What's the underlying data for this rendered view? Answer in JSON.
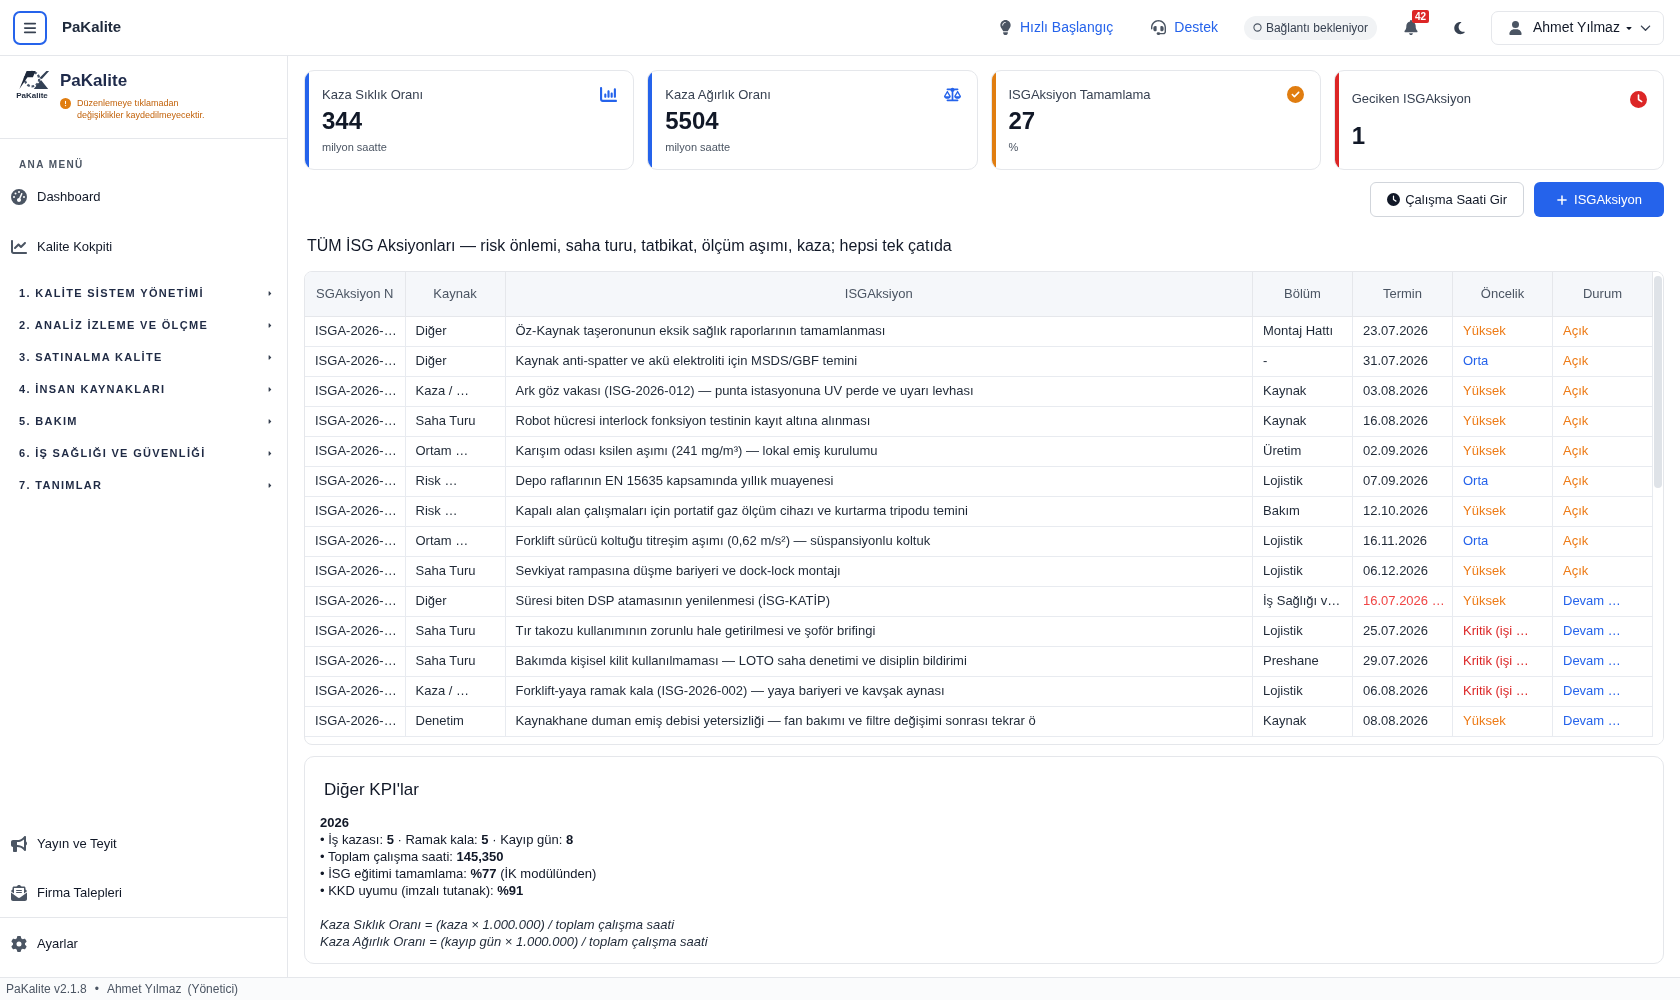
{
  "header": {
    "app_name": "PaKalite",
    "quick_start": "Hızlı Başlangıç",
    "support": "Destek",
    "connection": "Bağlantı bekleniyor",
    "notification_count": "42",
    "user": "Ahmet Yılmaz"
  },
  "sidebar": {
    "logo_wordmark": "PaKalite",
    "brand": "PaKalite",
    "notice": "Düzenlemeye tıklamadan değişiklikler kaydedilmeyecektir.",
    "menu_title": "ANA MENÜ",
    "links": [
      "Dashboard",
      "Kalite Kokpiti"
    ],
    "sections": [
      {
        "label": "1. KALİTE SİSTEM YÖNETİMİ",
        "expanded": false
      },
      {
        "label": "2. ANALİZ İZLEME VE ÖLÇME",
        "expanded": false
      },
      {
        "label": "3. SATINALMA KALİTE",
        "expanded": false
      },
      {
        "label": "4. İNSAN KAYNAKLARI",
        "expanded": false
      },
      {
        "label": "5. BAKIM",
        "expanded": false
      },
      {
        "label": "6. İŞ SAĞLIĞI VE GÜVENLİĞİ",
        "expanded": false
      },
      {
        "label": "7. TANIMLAR",
        "expanded": false
      }
    ],
    "bottom_links": [
      "Yayın ve Teyit",
      "Firma Talepleri"
    ],
    "settings": "Ayarlar"
  },
  "kpi_cards": [
    {
      "title": "Kaza Sıklık Oranı",
      "value": "344",
      "unit": "milyon saatte",
      "color": "#2563eb"
    },
    {
      "title": "Kaza Ağırlık Oranı",
      "value": "5504",
      "unit": "milyon saatte",
      "color": "#2563eb"
    },
    {
      "title": "ISGAksiyon Tamamlama",
      "value": "27",
      "unit": "%",
      "color": "#e07d10"
    },
    {
      "title": "Geciken ISGAksiyon",
      "value": "1",
      "color": "#dc2626"
    }
  ],
  "actions": {
    "hours_button": "Çalışma Saati Gir",
    "add_button": "ISGAksiyon"
  },
  "table": {
    "title": "TÜM İSG Aksiyonları — risk önlemi, saha turu, tatbikat, ölçüm aşımı, kaza; hepsi tek çatıda",
    "columns": [
      "SGAksiyon N",
      "Kaynak",
      "ISGAksiyon",
      "Bölüm",
      "Termin",
      "Öncelik",
      "Durum"
    ],
    "rows": [
      {
        "id": "ISGA-2026-…",
        "source": "Diğer",
        "action": "Öz-Kaynak taşeronunun eksik sağlık raporlarının tamamlanması",
        "department": "Montaj Hattı",
        "due": {
          "text": "23.07.2026",
          "overdue": false
        },
        "priority": {
          "text": "Yüksek",
          "color": "#ee7b16"
        },
        "status": {
          "text": "Açık",
          "color": "#ee7b16"
        }
      },
      {
        "id": "ISGA-2026-…",
        "source": "Diğer",
        "action": "Kaynak anti-spatter ve akü elektroliti için MSDS/GBF temini",
        "department": "-",
        "due": {
          "text": "31.07.2026",
          "overdue": false
        },
        "priority": {
          "text": "Orta",
          "color": "#2563eb"
        },
        "status": {
          "text": "Açık",
          "color": "#ee7b16"
        }
      },
      {
        "id": "ISGA-2026-…",
        "source": "Kaza / …",
        "action": "Ark göz vakası (ISG-2026-012) — punta istasyonuna UV perde ve uyarı levhası",
        "department": "Kaynak",
        "due": {
          "text": "03.08.2026",
          "overdue": false
        },
        "priority": {
          "text": "Yüksek",
          "color": "#ee7b16"
        },
        "status": {
          "text": "Açık",
          "color": "#ee7b16"
        }
      },
      {
        "id": "ISGA-2026-…",
        "source": "Saha Turu",
        "action": "Robot hücresi interlock fonksiyon testinin kayıt altına alınması",
        "department": "Kaynak",
        "due": {
          "text": "16.08.2026",
          "overdue": false
        },
        "priority": {
          "text": "Yüksek",
          "color": "#ee7b16"
        },
        "status": {
          "text": "Açık",
          "color": "#ee7b16"
        }
      },
      {
        "id": "ISGA-2026-…",
        "source": "Ortam …",
        "action": "Karışım odası ksilen aşımı (241 mg/m³) — lokal emiş kurulumu",
        "department": "Üretim",
        "due": {
          "text": "02.09.2026",
          "overdue": false
        },
        "priority": {
          "text": "Yüksek",
          "color": "#ee7b16"
        },
        "status": {
          "text": "Açık",
          "color": "#ee7b16"
        }
      },
      {
        "id": "ISGA-2026-…",
        "source": "Risk …",
        "action": "Depo raflarının EN 15635 kapsamında yıllık muayenesi",
        "department": "Lojistik",
        "due": {
          "text": "07.09.2026",
          "overdue": false
        },
        "priority": {
          "text": "Orta",
          "color": "#2563eb"
        },
        "status": {
          "text": "Açık",
          "color": "#ee7b16"
        }
      },
      {
        "id": "ISGA-2026-…",
        "source": "Risk …",
        "action": "Kapalı alan çalışmaları için portatif gaz ölçüm cihazı ve kurtarma tripodu temini",
        "department": "Bakım",
        "due": {
          "text": "12.10.2026",
          "overdue": false
        },
        "priority": {
          "text": "Yüksek",
          "color": "#ee7b16"
        },
        "status": {
          "text": "Açık",
          "color": "#ee7b16"
        }
      },
      {
        "id": "ISGA-2026-…",
        "source": "Ortam …",
        "action": "Forklift sürücü koltuğu titreşim aşımı (0,62 m/s²) — süspansiyonlu koltuk",
        "department": "Lojistik",
        "due": {
          "text": "16.11.2026",
          "overdue": false
        },
        "priority": {
          "text": "Orta",
          "color": "#2563eb"
        },
        "status": {
          "text": "Açık",
          "color": "#ee7b16"
        }
      },
      {
        "id": "ISGA-2026-…",
        "source": "Saha Turu",
        "action": "Sevkiyat rampasına düşme bariyeri ve dock-lock montajı",
        "department": "Lojistik",
        "due": {
          "text": "06.12.2026",
          "overdue": false
        },
        "priority": {
          "text": "Yüksek",
          "color": "#ee7b16"
        },
        "status": {
          "text": "Açık",
          "color": "#ee7b16"
        }
      },
      {
        "id": "ISGA-2026-…",
        "source": "Diğer",
        "action": "Süresi biten DSP atamasının yenilenmesi (İSG-KATİP)",
        "department": "İş Sağlığı v…",
        "due": {
          "text": "16.07.2026 …",
          "overdue": true
        },
        "priority": {
          "text": "Yüksek",
          "color": "#ee7b16"
        },
        "status": {
          "text": "Devam …",
          "color": "#2563eb"
        }
      },
      {
        "id": "ISGA-2026-…",
        "source": "Saha Turu",
        "action": "Tır takozu kullanımının zorunlu hale getirilmesi ve şoför brifingi",
        "department": "Lojistik",
        "due": {
          "text": "25.07.2026",
          "overdue": false
        },
        "priority": {
          "text": "Kritik (işi …",
          "color": "#dc2626"
        },
        "status": {
          "text": "Devam …",
          "color": "#2563eb"
        }
      },
      {
        "id": "ISGA-2026-…",
        "source": "Saha Turu",
        "action": "Bakımda kişisel kilit kullanılmaması — LOTO saha denetimi ve disiplin bildirimi",
        "department": "Preshane",
        "due": {
          "text": "29.07.2026",
          "overdue": false
        },
        "priority": {
          "text": "Kritik (işi …",
          "color": "#dc2626"
        },
        "status": {
          "text": "Devam …",
          "color": "#2563eb"
        }
      },
      {
        "id": "ISGA-2026-…",
        "source": "Kaza / …",
        "action": "Forklift-yaya ramak kala (ISG-2026-002) — yaya bariyeri ve kavşak aynası",
        "department": "Lojistik",
        "due": {
          "text": "06.08.2026",
          "overdue": false
        },
        "priority": {
          "text": "Kritik (işi …",
          "color": "#dc2626"
        },
        "status": {
          "text": "Devam …",
          "color": "#2563eb"
        }
      },
      {
        "id": "ISGA-2026-…",
        "source": "Denetim",
        "action": "Kaynakhane duman emiş debisi yetersizliği — fan bakımı ve filtre değişimi sonrası tekrar ö",
        "department": "Kaynak",
        "due": {
          "text": "08.08.2026",
          "overdue": false
        },
        "priority": {
          "text": "Yüksek",
          "color": "#ee7b16"
        },
        "status": {
          "text": "Devam …",
          "color": "#2563eb"
        }
      }
    ]
  },
  "kpi_panel": {
    "title": "Diğer KPI'lar",
    "year": "2026",
    "items": [
      "• İş kazası: **5** · Ramak kala: **5** · Kayıp gün: **8**",
      "• Toplam çalışma saati: **145,350**",
      "• İSG eğitimi tamamlama: **%77** (İK modülünden)",
      "• KKD uyumu (imzalı tutanak): **%91**"
    ],
    "formulas": [
      "Kaza Sıklık Oranı = (kaza × 1.000.000) / toplam çalışma saati",
      "Kaza Ağırlık Oranı = (kayıp gün × 1.000.000) / toplam çalışma saati"
    ]
  },
  "status_bar": {
    "version": "PaKalite v2.1.8",
    "separator": "•",
    "user": "Ahmet Yılmaz",
    "role": "(Yönetici)"
  }
}
